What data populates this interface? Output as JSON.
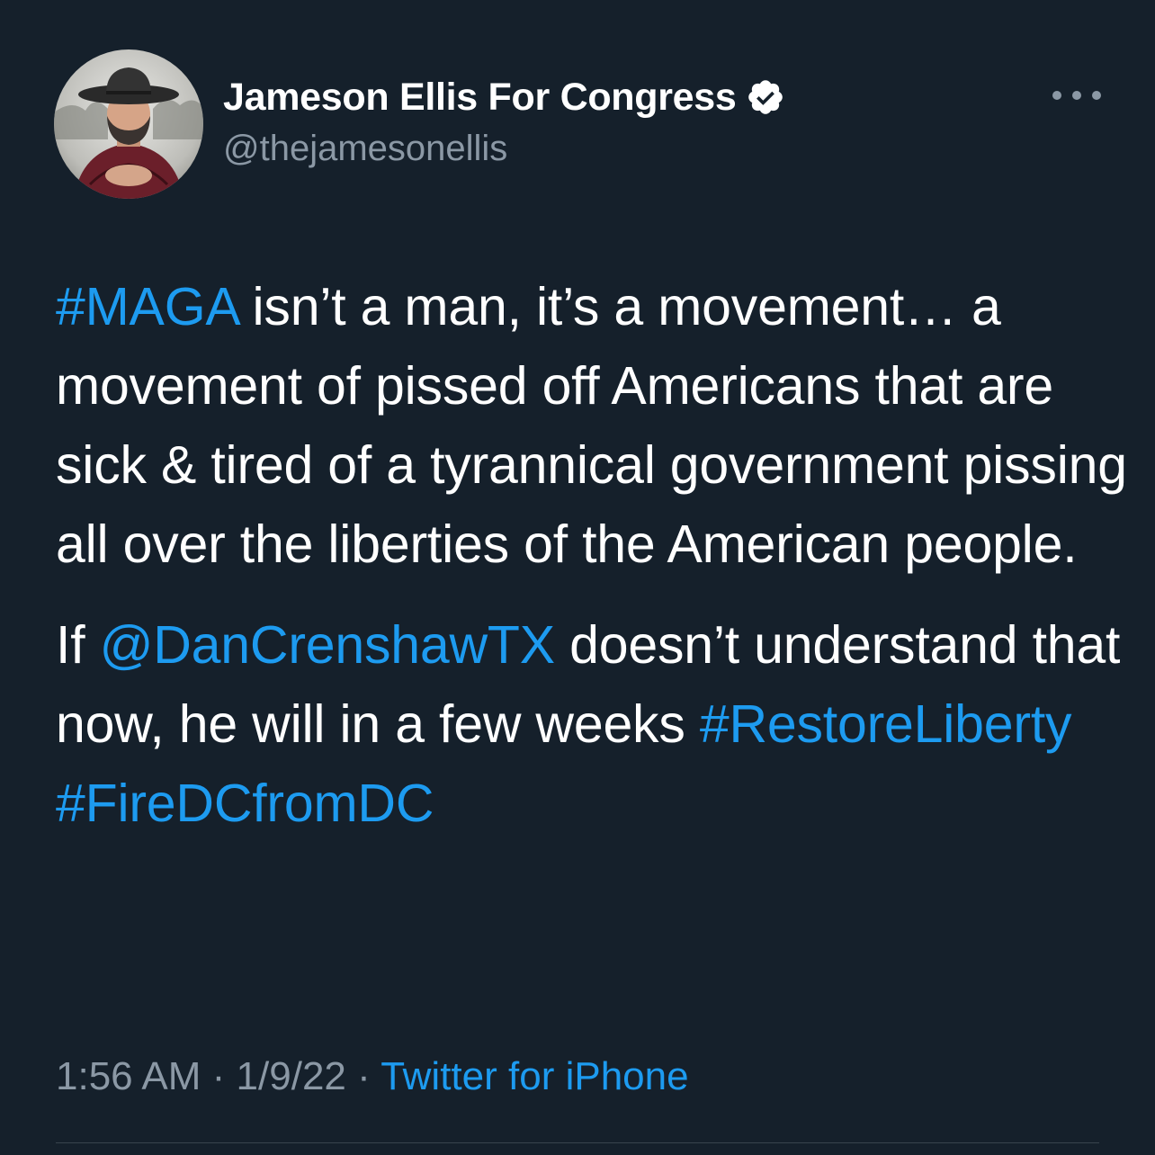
{
  "author": {
    "display_name": "Jameson Ellis For Congress",
    "handle": "@thejamesonellis",
    "verified": true
  },
  "more_icon": "more-horizontal-icon",
  "tweet": {
    "line1_hashtag": "#MAGA",
    "line1_text": " isn’t a man, it’s a movement… a movement of pissed off Americans that are sick & tired of a tyrannical government pissing all over the liberties of the American people.",
    "p2_start": "If ",
    "p2_mention": "@DanCrenshawTX",
    "p2_middle": " doesn’t understand that now, he will in a few weeks ",
    "p2_hashtag1": "#RestoreLiberty",
    "p2_hashtag2": "#FireDCfromDC"
  },
  "meta": {
    "time": "1:56 AM",
    "separator1": " · ",
    "date": "1/9/22",
    "separator2": " · ",
    "source": "Twitter for iPhone"
  },
  "colors": {
    "background": "#15202b",
    "text": "#ffffff",
    "secondary": "#8b98a5",
    "link": "#1d9bf0"
  }
}
